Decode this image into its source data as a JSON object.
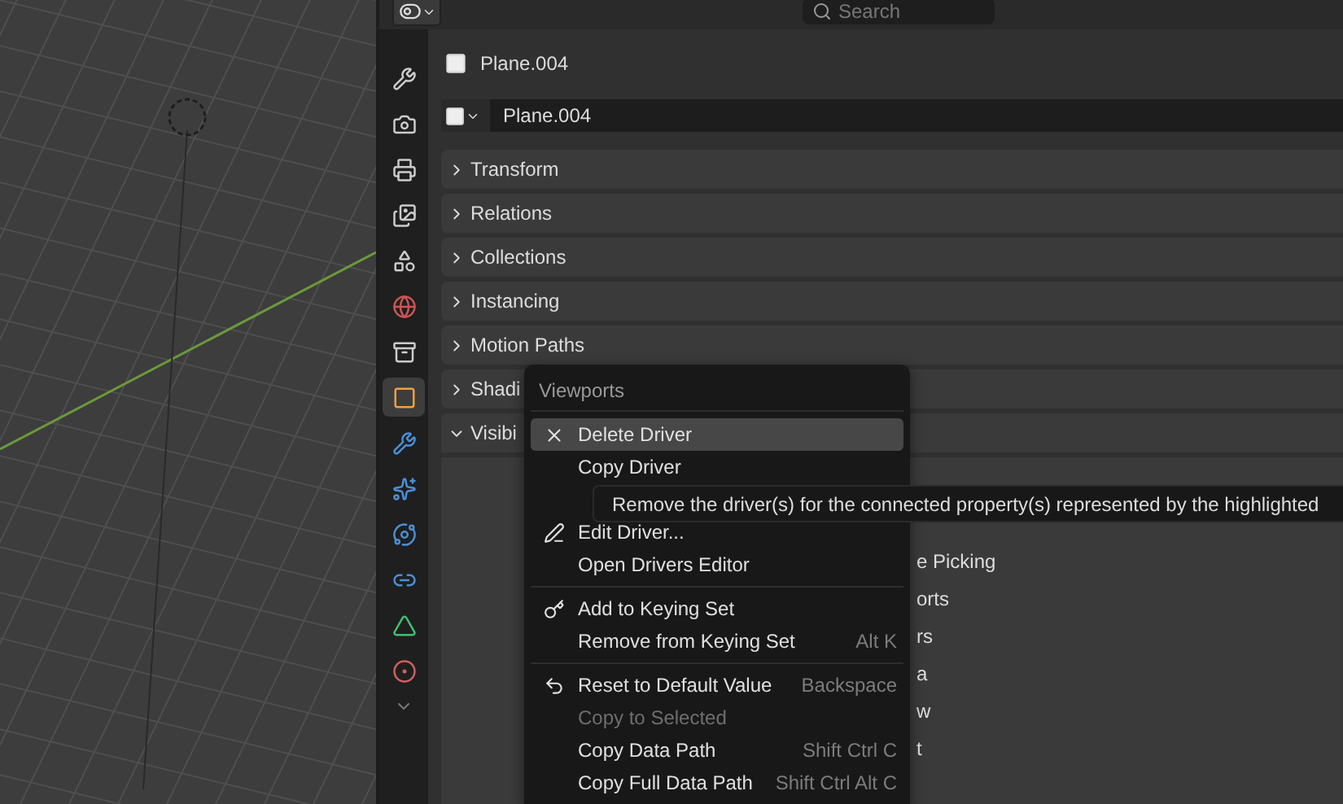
{
  "header": {
    "search": {
      "placeholder": "Search"
    }
  },
  "tabs": [
    {
      "kind": "tool",
      "selected": false
    },
    {
      "kind": "render",
      "selected": false
    },
    {
      "kind": "output",
      "selected": false
    },
    {
      "kind": "view-layer",
      "selected": false
    },
    {
      "kind": "scene",
      "selected": false
    },
    {
      "kind": "world",
      "selected": false
    },
    {
      "kind": "collection",
      "selected": false
    },
    {
      "kind": "object",
      "selected": true
    },
    {
      "kind": "modifier",
      "selected": false
    },
    {
      "kind": "particles",
      "selected": false
    },
    {
      "kind": "physics",
      "selected": false
    },
    {
      "kind": "constraint",
      "selected": false
    },
    {
      "kind": "data",
      "selected": false
    },
    {
      "kind": "material",
      "selected": false
    }
  ],
  "object": {
    "title": "Plane.004",
    "name_field": "Plane.004"
  },
  "panels": [
    {
      "label": "Transform",
      "expanded": false
    },
    {
      "label": "Relations",
      "expanded": false
    },
    {
      "label": "Collections",
      "expanded": false
    },
    {
      "label": "Instancing",
      "expanded": false
    },
    {
      "label": "Motion Paths",
      "expanded": false
    },
    {
      "label": "Shadi",
      "expanded": false
    },
    {
      "label": "Visibi",
      "expanded": true
    }
  ],
  "visibility_fragments": [
    "e Picking",
    "orts",
    "rs",
    "a",
    "w",
    "t"
  ],
  "menu": {
    "title": "Viewports",
    "groups": [
      [
        {
          "kind": "delete",
          "label": "Delete Driver",
          "selected": true,
          "disabled": false
        },
        {
          "kind": "plain",
          "label": "Copy Driver",
          "selected": false,
          "disabled": false
        },
        {
          "kind": "edit-driver",
          "label": "Edit Driver...",
          "selected": false,
          "disabled": false
        },
        {
          "kind": "plain",
          "label": "Open Drivers Editor",
          "selected": false,
          "disabled": false
        }
      ],
      [
        {
          "kind": "keying",
          "label": "Add to Keying Set",
          "selected": false,
          "disabled": false
        },
        {
          "kind": "plain",
          "label": "Remove from Keying Set",
          "shortcut": "Alt K",
          "selected": false,
          "disabled": false
        }
      ],
      [
        {
          "kind": "reset",
          "label": "Reset to Default Value",
          "shortcut": "Backspace",
          "selected": false,
          "disabled": false
        },
        {
          "kind": "plain",
          "label": "Copy to Selected",
          "selected": false,
          "disabled": true
        },
        {
          "kind": "plain",
          "label": "Copy Data Path",
          "shortcut": "Shift Ctrl C",
          "selected": false,
          "disabled": false
        },
        {
          "kind": "plain",
          "label": "Copy Full Data Path",
          "shortcut": "Shift Ctrl Alt C",
          "selected": false,
          "disabled": false
        }
      ]
    ]
  },
  "tooltip": "Remove the driver(s) for the connected property(s) represented by the highlighted"
}
